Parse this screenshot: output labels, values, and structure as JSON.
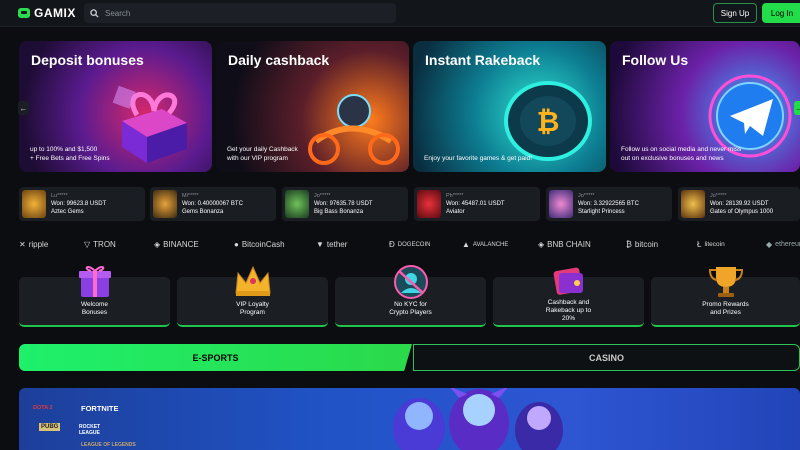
{
  "header": {
    "logo_text": "GAMIX",
    "search_placeholder": "Search",
    "signup_label": "Sign Up",
    "login_label": "Log In"
  },
  "promos": [
    {
      "title": "Deposit bonuses",
      "subtitle": "up to 100% and $1,500\n+ Free Bets and Free Spins"
    },
    {
      "title": "Daily cashback",
      "subtitle": "Get your daily Cashback\nwith our VIP program"
    },
    {
      "title": "Instant Rakeback",
      "subtitle": "Enjoy your favorite games & get paid!"
    },
    {
      "title": "Follow Us",
      "subtitle": "Follow us on social media and never miss\nout on exclusive bonuses and news"
    }
  ],
  "nav": {
    "prev_arrow": "←",
    "next_arrow": "→"
  },
  "wins": [
    {
      "user": "Lu*****",
      "amount": "Won: 99623.8 USDT",
      "game": "Aztec Gems"
    },
    {
      "user": "Mi*****",
      "amount": "Won: 0.40000067 BTC",
      "game": "Gems Bonanza"
    },
    {
      "user": "Jo*****",
      "amount": "Won: 97635.78 USDT",
      "game": "Big Bass Bonanza"
    },
    {
      "user": "Ph*****",
      "amount": "Won: 45487.01 USDT",
      "game": "Aviator"
    },
    {
      "user": "Jo*****",
      "amount": "Won: 3.32922565 BTC",
      "game": "Starlight Princess"
    },
    {
      "user": "Jo*****",
      "amount": "Won: 28139.92 USDT",
      "game": "Gates of Olympus 1000"
    }
  ],
  "crypto": [
    "ripple",
    "TRON",
    "BINANCE",
    "BitcoinCash",
    "tether",
    "DOGECOIN",
    "AVALANCHE",
    "BNB CHAIN",
    "bitcoin",
    "litecoin",
    "ethereum"
  ],
  "features": [
    {
      "label": "Welcome\nBonuses"
    },
    {
      "label": "VIP Loyalty\nProgram"
    },
    {
      "label": "No KYC for\nCrypto Players"
    },
    {
      "label": "Cashback and\nRakeback up to\n20%"
    },
    {
      "label": "Promo Rewards\nand Prizes"
    }
  ],
  "tabs": {
    "esports": "E-SPORTS",
    "casino": "CASINO"
  },
  "esports_brands": [
    "DOTA 2",
    "FORTNITE",
    "PUBG",
    "ROCKET LEAGUE",
    "LEAGUE OF LEGENDS"
  ],
  "colors": {
    "accent": "#23dc4a",
    "background": "#0b0d10",
    "card": "#1a1d22"
  }
}
